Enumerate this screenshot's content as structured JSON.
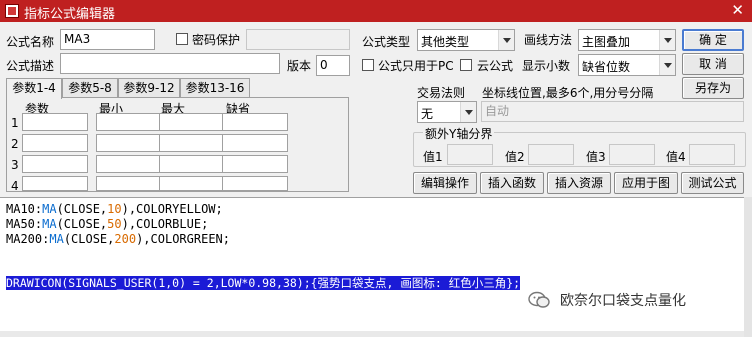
{
  "window": {
    "title": "指标公式编辑器",
    "close_glyph": "✕"
  },
  "form": {
    "name_label": "公式名称",
    "name_value": "MA3",
    "password_label": "密码保护",
    "desc_label": "公式描述",
    "desc_value": "",
    "version_label": "版本",
    "version_value": "0",
    "type_label": "公式类型",
    "type_value": "其他类型",
    "draw_label": "画线方法",
    "draw_value": "主图叠加",
    "pc_only_label": "公式只用于PC",
    "cloud_label": "云公式",
    "decimals_label": "显示小数",
    "decimals_value": "缺省位数"
  },
  "buttons": {
    "ok": "确  定",
    "cancel": "取  消",
    "save_as": "另存为",
    "edit_ops": "编辑操作",
    "insert_func": "插入函数",
    "insert_res": "插入资源",
    "apply_chart": "应用于图",
    "test": "测试公式"
  },
  "tabs": [
    "参数1-4",
    "参数5-8",
    "参数9-12",
    "参数13-16"
  ],
  "params": {
    "headers": [
      "参数",
      "最小",
      "最大",
      "缺省"
    ],
    "rows": [
      "1",
      "2",
      "3",
      "4"
    ]
  },
  "trade_rule": {
    "label": "交易法则",
    "value": "无"
  },
  "coord": {
    "label": "坐标线位置,最多6个,用分号分隔",
    "value": "自动"
  },
  "extra_y": {
    "label": "额外Y轴分界",
    "values": [
      "值1",
      "值2",
      "值3",
      "值4"
    ]
  },
  "code": {
    "l1": {
      "a": "MA10:",
      "b": "MA",
      "c": "(CLOSE,",
      "d": "10",
      "e": "),COLORYELLOW;"
    },
    "l2": {
      "a": "MA50:",
      "b": "MA",
      "c": "(CLOSE,",
      "d": "50",
      "e": "),COLORBLUE;"
    },
    "l3": {
      "a": "MA200:",
      "b": "MA",
      "c": "(CLOSE,",
      "d": "200",
      "e": "),COLORGREEN;"
    },
    "l4": "DRAWICON(SIGNALS_USER(1,0) = 2,LOW*0.98,38);{强势口袋支点, 画图标: 红色小三角};"
  },
  "watermark": "欧奈尔口袋支点量化",
  "colors": {
    "titlebar": "#bf2020",
    "highlight": "#1b1bd6",
    "function": "#0a6ccf",
    "number": "#d86a00"
  }
}
